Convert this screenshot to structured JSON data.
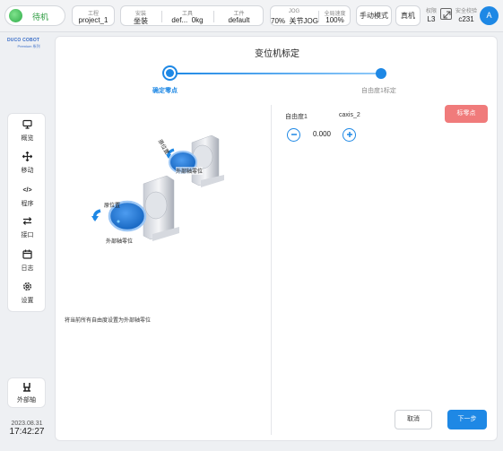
{
  "topbar": {
    "status": "待机",
    "project": {
      "label": "工程",
      "value": "project_1"
    },
    "install": {
      "label": "安装",
      "value": "坐装"
    },
    "tool": {
      "label": "工具",
      "value1": "def...",
      "value2": "0kg"
    },
    "workpiece": {
      "label": "工件",
      "value": "default"
    },
    "jog": {
      "label": "JOG",
      "value1": "70%",
      "value2": "关节JOG"
    },
    "speed": {
      "label": "全局速度",
      "value": "100%"
    },
    "mode": "手动模式",
    "real": "真机",
    "level": {
      "label": "权限",
      "value": "L3"
    },
    "safety": {
      "label": "安全校验",
      "value": "c231"
    },
    "user_initial": "A"
  },
  "sidebar": {
    "logo_line1": "DUCO COBOT",
    "logo_line2": "Premium 系列",
    "items": [
      {
        "label": "概览",
        "icon": "monitor-icon"
      },
      {
        "label": "移动",
        "icon": "move-icon"
      },
      {
        "label": "程序",
        "icon": "code-icon"
      },
      {
        "label": "接口",
        "icon": "swap-icon"
      },
      {
        "label": "日志",
        "icon": "calendar-icon"
      },
      {
        "label": "设置",
        "icon": "gear-icon"
      }
    ],
    "external_axis": "外部轴",
    "date": "2023.08.31",
    "time": "17:42:27"
  },
  "main": {
    "title": "变位机标定",
    "step1": "确定零点",
    "step2": "自由度1标定",
    "illus": {
      "top_home": "原位置",
      "top_zero": "外部轴零位",
      "bottom_home": "原位置",
      "bottom_zero": "外部轴零位"
    },
    "description": "将当前所有自由度设置为外部轴零位",
    "axis_header1": "自由度1",
    "axis_header2": "caxis_2",
    "reset_button": "标零点",
    "stepper_value": "0.000",
    "cancel_button": "取消",
    "next_button": "下一步"
  },
  "colors": {
    "accent": "#1e88e5",
    "danger": "#f07b7b",
    "status_green": "#2eaa48"
  }
}
